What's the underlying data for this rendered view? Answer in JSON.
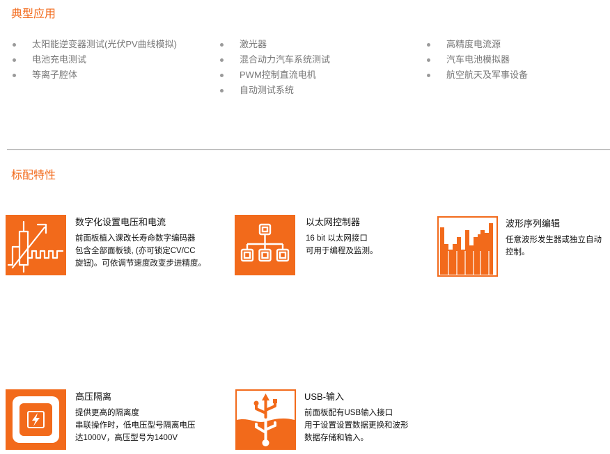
{
  "applications": {
    "title": "典型应用",
    "columns": [
      [
        "太阳能逆变器测试(光伏PV曲线模拟)",
        "电池充电测试",
        "等离子腔体"
      ],
      [
        "激光器",
        "混合动力汽车系统测试",
        "PWM控制直流电机",
        "自动测试系统"
      ],
      [
        "高精度电流源",
        "汽车电池模拟器",
        "航空航天及军事设备"
      ]
    ]
  },
  "features": {
    "title": "标配特性",
    "items": [
      {
        "icon": "encoder-knob-icon",
        "title": "数字化设置电压和电流",
        "lines": [
          "前面板植入课改长寿命数字编码器",
          "包含全部面板锁, (亦可锁定CV/CC",
          "旋钮)。可依调节速度改变步进精度。"
        ]
      },
      {
        "icon": "network-topology-icon",
        "title": "以太网控制器",
        "lines": [
          "16 bit 以太网接口",
          "可用于编程及监测。"
        ]
      },
      {
        "icon": "waveform-sequence-icon",
        "title": "波形序列编辑",
        "lines": [
          "任意波形发生器或独立自动",
          "控制。"
        ]
      },
      {
        "icon": "isolation-lightning-icon",
        "title": "高压隔离",
        "lines": [
          "提供更高的隔离度",
          "串联操作时，低电压型号隔离电压",
          "达1000V，高压型号为1400V"
        ]
      },
      {
        "icon": "usb-icon",
        "title": "USB-输入",
        "lines": [
          "前面板配有USB输入接口",
          "用于设置设置数据更换和波形",
          "数据存储和输入。"
        ]
      }
    ]
  },
  "colors": {
    "accent": "#f26a1b",
    "bullet": "#9a9a9a",
    "muted_text": "#777777"
  }
}
